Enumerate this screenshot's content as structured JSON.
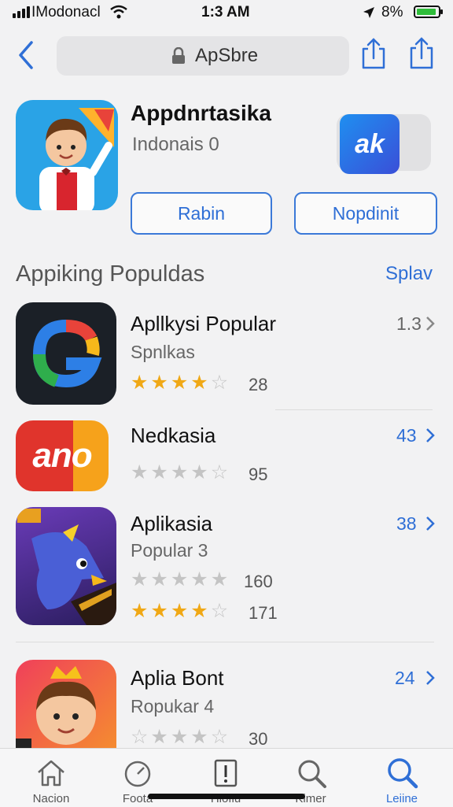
{
  "status_bar": {
    "carrier": "IModonacl",
    "time": "1:3 AM",
    "battery_pct": "8%"
  },
  "nav": {
    "url_text": "ApSbre"
  },
  "featured": {
    "title": "Appdnrtasika",
    "subtitle": "Indonais 0",
    "button_left": "Rabin",
    "button_right": "Nopdinit",
    "side_badge_text": "ak"
  },
  "section": {
    "title": "Appiking Populdas",
    "action": "Splav"
  },
  "apps": [
    {
      "name": "Apllkysi Popular",
      "subtitle": "Spnlkas",
      "stars_filled": 4,
      "ratings": [
        {
          "filled": 4,
          "count": "28"
        }
      ],
      "right": "1.3",
      "right_color": "#666666",
      "icon_text": ""
    },
    {
      "name": "Nedkasia",
      "subtitle": "",
      "ratings": [
        {
          "filled": 0,
          "count": "95"
        }
      ],
      "right": "43",
      "right_color": "#2f6fd6",
      "icon_text": "ano"
    },
    {
      "name": "Aplikasia",
      "subtitle": "Popular 3",
      "ratings": [
        {
          "filled": 0,
          "count": "160"
        },
        {
          "filled": 4,
          "count": "171"
        }
      ],
      "right": "38",
      "right_color": "#2f6fd6",
      "icon_text": ""
    },
    {
      "name": "Aplia Bont",
      "subtitle": "Ropukar 4",
      "ratings": [
        {
          "filled": 0,
          "count": "30"
        }
      ],
      "right": "24",
      "right_color": "#2f6fd6",
      "icon_text": ""
    }
  ],
  "tabs": [
    {
      "label": "Nacion",
      "icon": "home-icon"
    },
    {
      "label": "Foota",
      "icon": "clock-icon"
    },
    {
      "label": "Hloflu",
      "icon": "alert-icon"
    },
    {
      "label": "Kimer",
      "icon": "search-icon"
    },
    {
      "label": "Leiine",
      "icon": "search-icon",
      "active": true
    }
  ],
  "colors": {
    "accent": "#2f6fd6",
    "star": "#f0a815"
  }
}
